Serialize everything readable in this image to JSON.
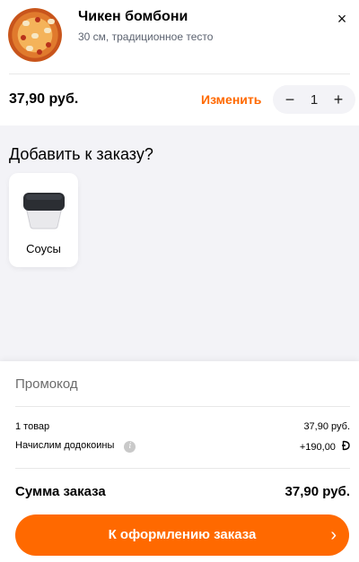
{
  "item": {
    "name": "Чикен бомбони",
    "description": "30 см, традиционное тесто",
    "price": "37,90 руб.",
    "change_label": "Изменить",
    "quantity": "1",
    "minus": "−",
    "plus": "+",
    "close": "×"
  },
  "addons": {
    "title": "Добавить к заказу?",
    "items": [
      {
        "label": "Соусы",
        "icon": "sauce-cup-icon"
      }
    ]
  },
  "summary": {
    "promo_placeholder": "Промокод",
    "items_label": "1 товар",
    "items_value": "37,90 руб.",
    "coins_label": "Начислим додокоины",
    "coins_value": "+190,00",
    "total_label": "Сумма заказа",
    "total_value": "37,90 руб.",
    "checkout_label": "К оформлению заказа",
    "checkout_arrow": "›"
  },
  "colors": {
    "accent": "#ff6900",
    "background_gray": "#f3f3f7"
  }
}
